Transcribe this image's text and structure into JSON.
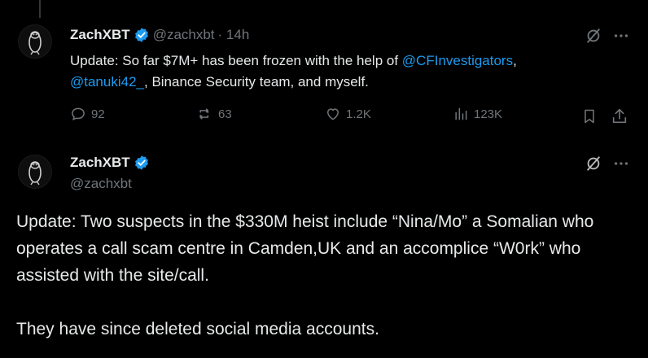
{
  "tweet1": {
    "name": "ZachXBT",
    "handle": "@zachxbt",
    "time": "· 14h",
    "text_part1": "Update: So far $7M+ has been frozen with the help of ",
    "mention1": "@CFInvestigators",
    "text_part2": ",",
    "mention2": "@tanuki42_",
    "text_part3": ", Binance Security team, and myself.",
    "replies": "92",
    "reposts": "63",
    "likes": "1.2K",
    "views": "123K"
  },
  "tweet2": {
    "name": "ZachXBT",
    "handle": "@zachxbt",
    "paragraph1": "Update: Two suspects in the $330M heist include “Nina/Mo” a Somalian who operates a call scam centre in Camden,UK and an accomplice “W0rk” who assisted with the site/call.",
    "paragraph2": "They have since deleted social media accounts."
  },
  "colors": {
    "background": "#000000",
    "text": "#e7e9ea",
    "muted": "#71767b",
    "link": "#1d9bf0",
    "verified": "#1d9bf0"
  },
  "icons": [
    "verified-badge-icon",
    "grok-icon",
    "more-icon",
    "reply-icon",
    "repost-icon",
    "like-icon",
    "views-icon",
    "bookmark-icon",
    "share-icon"
  ]
}
